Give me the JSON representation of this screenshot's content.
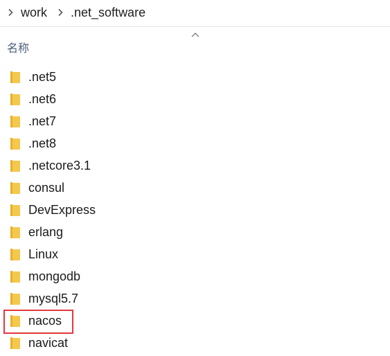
{
  "breadcrumb": {
    "items": [
      {
        "label": "work"
      },
      {
        "label": ".net_software"
      }
    ]
  },
  "column_header": {
    "name_label": "名称",
    "sort_icon": "chevron-up-icon"
  },
  "files": [
    {
      "name": ".net5",
      "icon": "folder-icon"
    },
    {
      "name": ".net6",
      "icon": "folder-icon"
    },
    {
      "name": ".net7",
      "icon": "folder-icon"
    },
    {
      "name": ".net8",
      "icon": "folder-icon"
    },
    {
      "name": ".netcore3.1",
      "icon": "folder-icon"
    },
    {
      "name": "consul",
      "icon": "folder-icon"
    },
    {
      "name": "DevExpress",
      "icon": "folder-icon"
    },
    {
      "name": "erlang",
      "icon": "folder-icon"
    },
    {
      "name": "Linux",
      "icon": "folder-icon"
    },
    {
      "name": "mongodb",
      "icon": "folder-icon"
    },
    {
      "name": "mysql5.7",
      "icon": "folder-icon"
    },
    {
      "name": "nacos",
      "icon": "folder-icon",
      "highlighted": true
    },
    {
      "name": "navicat",
      "icon": "folder-icon"
    }
  ],
  "colors": {
    "folder_body": "#f4c84d",
    "folder_shade": "#e8b02e",
    "highlight_border": "#e0393e",
    "header_text": "#4c607a"
  }
}
